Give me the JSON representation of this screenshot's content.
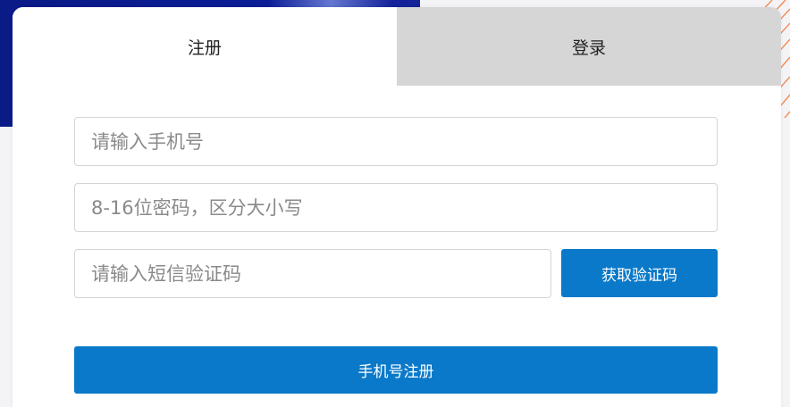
{
  "tabs": {
    "register_label": "注册",
    "login_label": "登录"
  },
  "form": {
    "phone_placeholder": "请输入手机号",
    "password_placeholder": "8-16位密码，区分大小写",
    "sms_placeholder": "请输入短信验证码",
    "get_code_label": "获取验证码",
    "submit_label": "手机号注册"
  },
  "colors": {
    "accent": "#0a79c9",
    "inactive_tab": "#d6d6d6",
    "background_navy": "#0b1d95",
    "decor_lines": "#f07a3a"
  }
}
